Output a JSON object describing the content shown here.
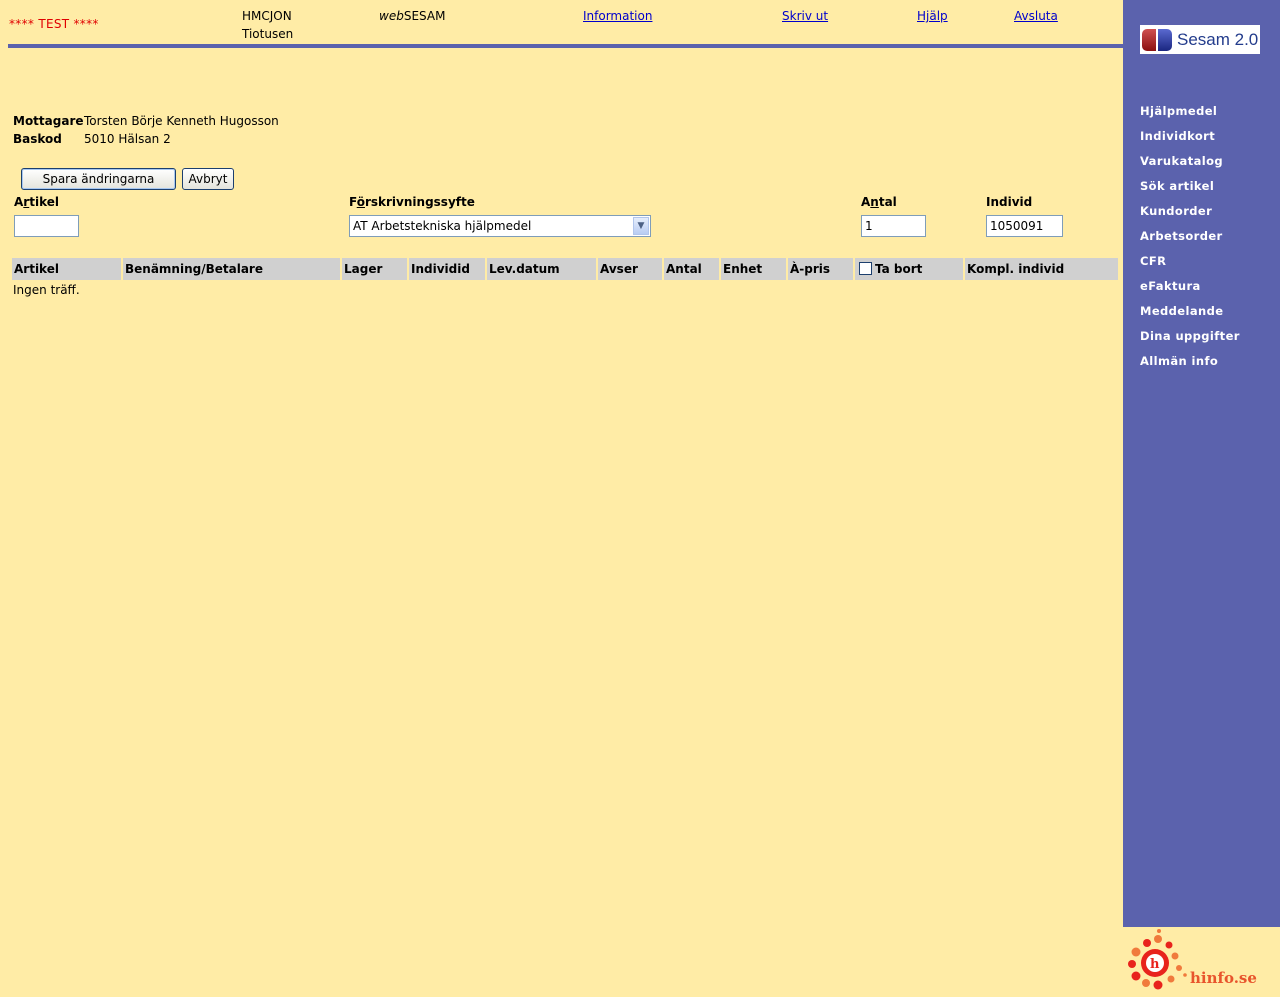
{
  "header": {
    "test_label": "**** TEST ****",
    "user_code": "HMCJON",
    "user_name": "Tiotusen",
    "app_name_italic": "web",
    "app_name_rest": "SESAM",
    "links": [
      {
        "label": "Information"
      },
      {
        "label": "Skriv ut"
      },
      {
        "label": "Hjälp"
      },
      {
        "label": "Avsluta"
      }
    ]
  },
  "recipient": {
    "mottagare_label": "Mottagare",
    "mottagare_value": "Torsten Börje Kenneth Hugosson",
    "baskod_label": "Baskod",
    "baskod_value": "5010 Hälsan 2"
  },
  "buttons": {
    "save": "Spara ändringarna",
    "cancel": "Avbryt"
  },
  "form": {
    "artikel": {
      "label_pre": "A",
      "label_accel": "r",
      "label_post": "tikel",
      "value": ""
    },
    "syfte": {
      "label_pre": "F",
      "label_accel": "ö",
      "label_post": "rskrivningssyfte",
      "selected": "AT Arbetstekniska hjälpmedel"
    },
    "antal": {
      "label_pre": "A",
      "label_accel": "n",
      "label_post": "tal",
      "value": "1"
    },
    "individ": {
      "label": "Individ",
      "value": "1050091"
    }
  },
  "table": {
    "columns": [
      "Artikel",
      "Benämning/Betalare",
      "Lager",
      "Individid",
      "Lev.datum",
      "Avser",
      "Antal",
      "Enhet",
      "À-pris",
      "Ta bort",
      "Kompl. individ"
    ],
    "empty_message": "Ingen träff."
  },
  "sidebar": {
    "logo_text": "Sesam 2.0",
    "items": [
      {
        "label": "Hjälpmedel"
      },
      {
        "label": "Individkort"
      },
      {
        "label": "Varukatalog"
      },
      {
        "label": "Sök artikel"
      },
      {
        "label": "Kundorder"
      },
      {
        "label": "Arbetsorder"
      },
      {
        "label": "CFR"
      },
      {
        "label": "eFaktura"
      },
      {
        "label": "Meddelande"
      },
      {
        "label": "Dina uppgifter"
      },
      {
        "label": "Allmän info"
      }
    ],
    "footer_logo_text": "hinfo.se"
  },
  "colors": {
    "background": "#ffeca6",
    "sidebar": "#5b62ad",
    "test_label": "#e00000",
    "link": "#0000cc",
    "table_header": "#d0d0d0"
  }
}
